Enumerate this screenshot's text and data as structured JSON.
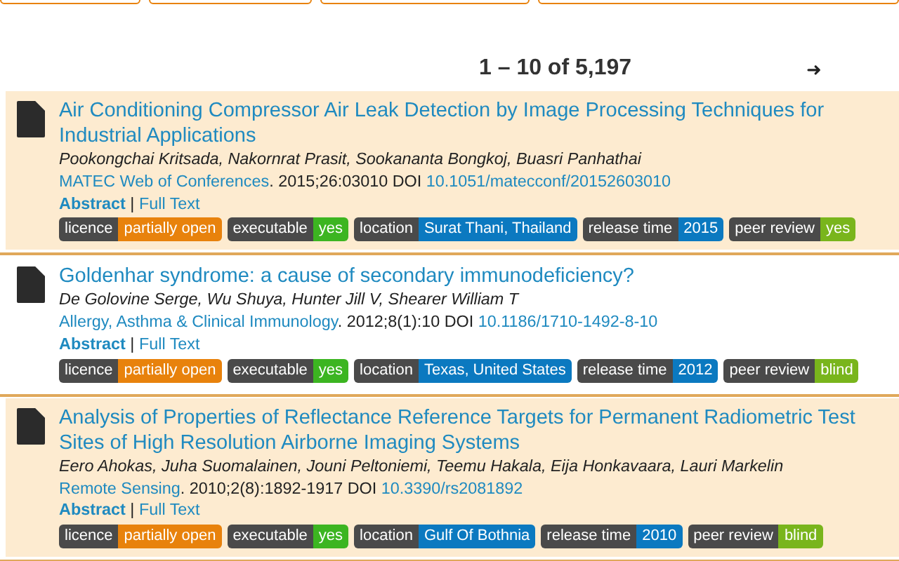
{
  "pager": {
    "range": "1 – 10 of 5,197",
    "next": "➜"
  },
  "results": [
    {
      "highlighted": true,
      "title": "Air Conditioning Compressor Air Leak Detection by Image Processing Techniques for Industrial Applications",
      "authors": "Pookongchai Kritsada, Nakornrat Prasit, Sookananta Bongkoj, Buasri Panhathai",
      "journal": "MATEC Web of Conferences",
      "citation": ". 2015;26:03010 DOI ",
      "doi": "10.1051/matecconf/20152603010",
      "abstract": "Abstract",
      "separator": "|",
      "full_text": "Full Text",
      "badges": [
        {
          "label": "licence",
          "value": "partially open",
          "color": "#e8820c"
        },
        {
          "label": "executable",
          "value": "yes",
          "color": "#3cb521"
        },
        {
          "label": "location",
          "value": "Surat Thani, Thailand",
          "color": "#0b79c0"
        },
        {
          "label": "release time",
          "value": "2015",
          "color": "#0b79c0"
        },
        {
          "label": "peer review",
          "value": "yes",
          "color": "#79b51c"
        }
      ]
    },
    {
      "highlighted": false,
      "title": "Goldenhar syndrome: a cause of secondary immunodeficiency?",
      "authors": "De Golovine Serge, Wu Shuya, Hunter Jill V, Shearer William T",
      "journal": "Allergy, Asthma & Clinical Immunology",
      "citation": ". 2012;8(1):10 DOI ",
      "doi": "10.1186/1710-1492-8-10",
      "abstract": "Abstract",
      "separator": "|",
      "full_text": "Full Text",
      "badges": [
        {
          "label": "licence",
          "value": "partially open",
          "color": "#e8820c"
        },
        {
          "label": "executable",
          "value": "yes",
          "color": "#3cb521"
        },
        {
          "label": "location",
          "value": "Texas, United States",
          "color": "#0b79c0"
        },
        {
          "label": "release time",
          "value": "2012",
          "color": "#0b79c0"
        },
        {
          "label": "peer review",
          "value": "blind",
          "color": "#79b51c"
        }
      ]
    },
    {
      "highlighted": true,
      "title": "Analysis of Properties of Reflectance Reference Targets for Permanent Radiometric Test Sites of High Resolution Airborne Imaging Systems",
      "authors": "Eero Ahokas, Juha Suomalainen, Jouni Peltoniemi, Teemu Hakala, Eija Honkavaara, Lauri Markelin",
      "journal": "Remote Sensing",
      "citation": ". 2010;2(8):1892-1917 DOI ",
      "doi": "10.3390/rs2081892",
      "abstract": "Abstract",
      "separator": "|",
      "full_text": "Full Text",
      "badges": [
        {
          "label": "licence",
          "value": "partially open",
          "color": "#e8820c"
        },
        {
          "label": "executable",
          "value": "yes",
          "color": "#3cb521"
        },
        {
          "label": "location",
          "value": "Gulf Of Bothnia",
          "color": "#0b79c0"
        },
        {
          "label": "release time",
          "value": "2010",
          "color": "#0b79c0"
        },
        {
          "label": "peer review",
          "value": "blind",
          "color": "#79b51c"
        }
      ]
    }
  ]
}
